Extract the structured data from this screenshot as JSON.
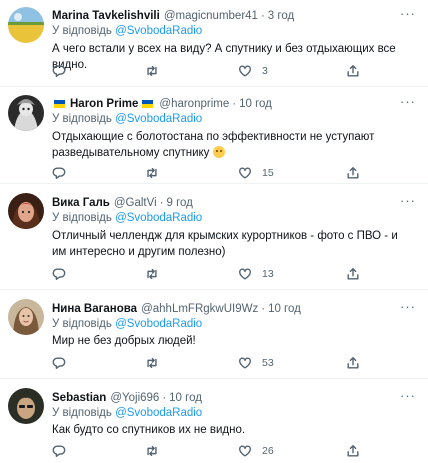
{
  "reply_prefix": "У відповідь",
  "more_label": "···",
  "tweets": [
    {
      "name": "Marina Tavkelishvili",
      "handle": "@magicnumber41",
      "time": "3 год",
      "mention": "@SvobodaRadio",
      "text": "А чего встали у всех на виду? А спутнику и без отдыхающих все видно.",
      "replies": "",
      "retweets": "",
      "likes": "3"
    },
    {
      "name": "Haron Prime",
      "handle": "@haronprime",
      "time": "10 год",
      "mention": "@SvobodaRadio",
      "text": "Отдыхающие с болотостана по эффективности не уступают разведывательному спутнику",
      "replies": "",
      "retweets": "",
      "likes": "15"
    },
    {
      "name": "Вика Галь",
      "handle": "@GaltVi",
      "time": "9 год",
      "mention": "@SvobodaRadio",
      "text": "Отличный челлендж для крымских курортников - фото с ПВО - и им интересно и другим полезно)",
      "replies": "",
      "retweets": "",
      "likes": "13"
    },
    {
      "name": "Нина Ваганова",
      "handle": "@ahhLmFRgkwUI9Wz",
      "time": "10 год",
      "mention": "@SvobodaRadio",
      "text": "Мир не без добрых людей!",
      "replies": "",
      "retweets": "",
      "likes": "53"
    },
    {
      "name": "Sebastian",
      "handle": "@Yoji696",
      "time": "10 год",
      "mention": "@SvobodaRadio",
      "text": "Как будто со спутников их не видно.",
      "replies": "",
      "retweets": "",
      "likes": "26"
    }
  ],
  "colors": {
    "link": "#1d9bf0",
    "text": "#0f1419",
    "muted": "#536471",
    "divider": "#eff3f4",
    "flag_blue": "#0057b7",
    "flag_yellow": "#ffd700"
  }
}
